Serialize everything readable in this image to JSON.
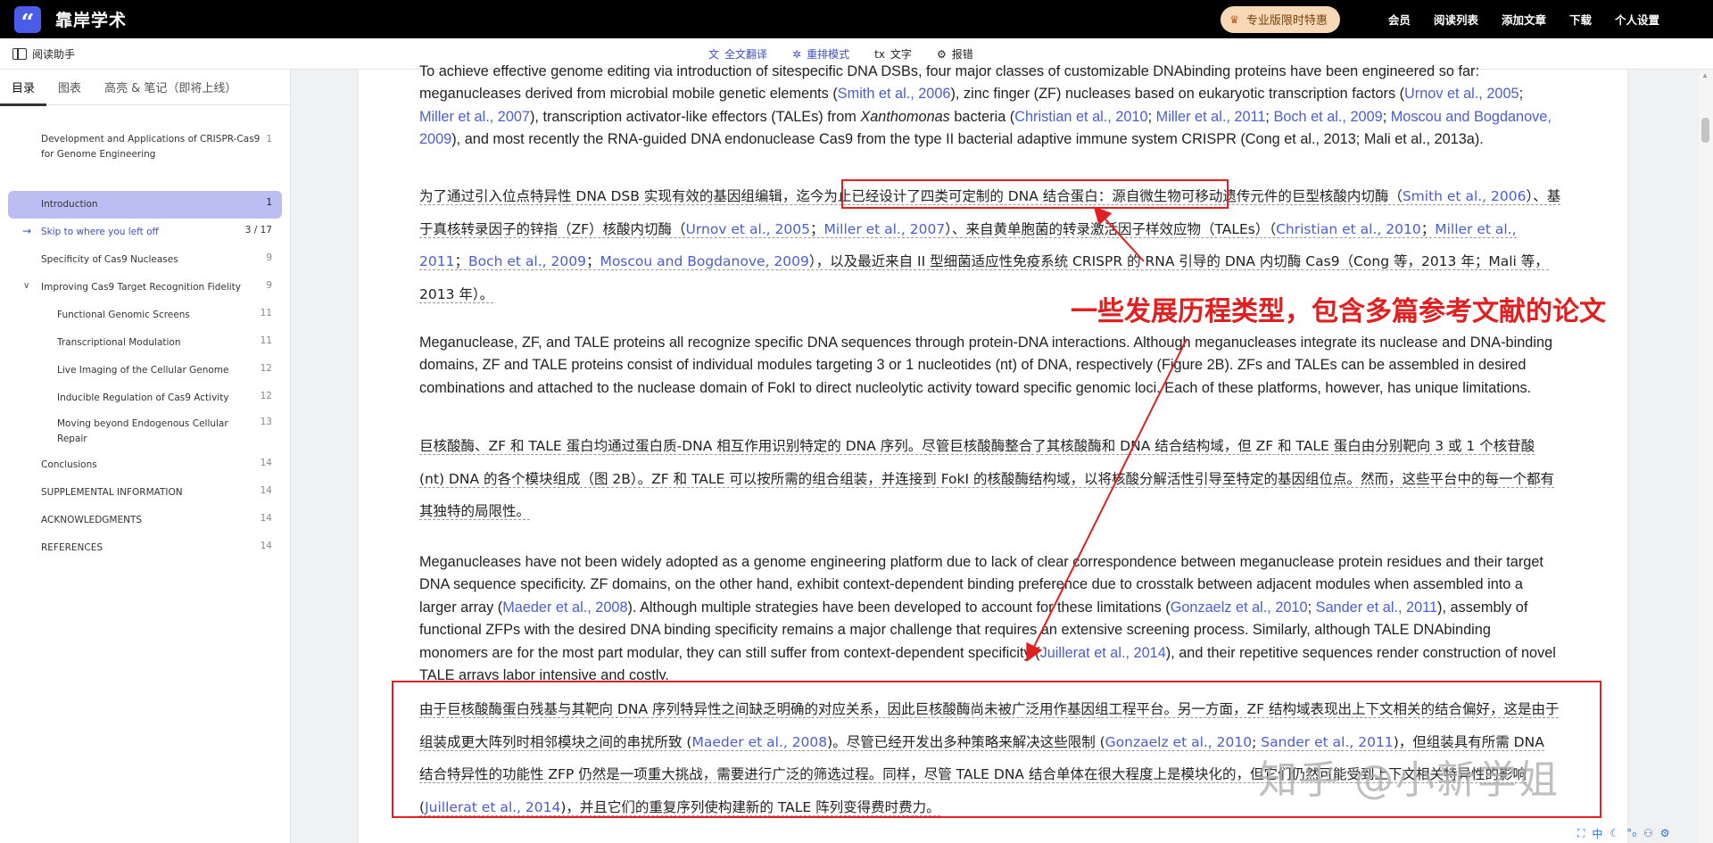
{
  "topbar": {
    "logo_glyph": "“",
    "app_title": "靠岸学术",
    "promo_label": "专业版限时特惠",
    "nav": [
      "会员",
      "阅读列表",
      "添加文章",
      "下载",
      "个人设置"
    ]
  },
  "subbar": {
    "assistant_label": "阅读助手",
    "tools": [
      {
        "icon": "translate-icon",
        "glyph": "文",
        "label": "全文翻译"
      },
      {
        "icon": "reflow-icon",
        "glyph": "✲",
        "label": "重排模式"
      },
      {
        "icon": "text-icon",
        "glyph": "tx",
        "label": "文字"
      },
      {
        "icon": "settings-icon",
        "glyph": "⚙",
        "label": "报错"
      }
    ]
  },
  "sidebar": {
    "tabs": [
      "目录",
      "图表",
      "高亮 & 笔记（即将上线）"
    ],
    "toc": [
      {
        "label": "Development and Applications of CRISPR-Cas9 for Genome Engineering",
        "page": "1"
      },
      {
        "label": "Introduction",
        "page": "1"
      },
      {
        "label": "Skip to where you left off",
        "page": "3 / 17"
      },
      {
        "label": "Specificity of Cas9 Nucleases",
        "page": "9"
      },
      {
        "label": "Improving Cas9 Target Recognition Fidelity",
        "page": "9"
      },
      {
        "label": "Functional Genomic Screens",
        "page": "11"
      },
      {
        "label": "Transcriptional Modulation",
        "page": "11"
      },
      {
        "label": "Live Imaging of the Cellular Genome",
        "page": "12"
      },
      {
        "label": "Inducible Regulation of Cas9 Activity",
        "page": "12"
      },
      {
        "label": "Moving beyond Endogenous Cellular Repair",
        "page": "13"
      },
      {
        "label": "Conclusions",
        "page": "14"
      },
      {
        "label": "SUPPLEMENTAL INFORMATION",
        "page": "14"
      },
      {
        "label": "ACKNOWLEDGMENTS",
        "page": "14"
      },
      {
        "label": "REFERENCES",
        "page": "14"
      }
    ]
  },
  "document": {
    "p1_en": [
      [
        "t",
        "To achieve effective genome editing via introduction of sitespecific DNA DSBs, four major classes of customizable DNAbinding proteins have been engineered so far: meganucleases derived from microbial mobile genetic elements ("
      ],
      [
        "c",
        "Smith et al., 2006"
      ],
      [
        "t",
        "), zinc finger (ZF) nucleases based on eukaryotic transcription factors ("
      ],
      [
        "c",
        "Urnov et al., 2005"
      ],
      [
        "t",
        "; "
      ],
      [
        "c",
        "Miller et al., 2007"
      ],
      [
        "t",
        "), transcription activator-like effectors (TALEs) from "
      ],
      [
        "i",
        "Xanthomonas"
      ],
      [
        "t",
        " bacteria ("
      ],
      [
        "c",
        "Christian et al., 2010"
      ],
      [
        "t",
        "; "
      ],
      [
        "c",
        "Miller et al., 2011"
      ],
      [
        "t",
        "; "
      ],
      [
        "c",
        "Boch et al., 2009"
      ],
      [
        "t",
        "; "
      ],
      [
        "c",
        "Moscou and Bogdanove, 2009"
      ],
      [
        "t",
        "), and most recently the RNA-guided DNA endonuclease Cas9 from the type II bacterial adaptive immune system CRISPR (Cong et al., 2013; Mali et al., 2013a)."
      ]
    ],
    "p1_zh": [
      [
        "t",
        "为了通过引入位点特异性 DNA DSB 实现有效的基因组编辑，迄今为止已经设计了四类可定制的 DNA 结合蛋白：源自微生物可移动遗传元件的巨型核酸内切酶（"
      ],
      [
        "c",
        "Smith et al., 2006"
      ],
      [
        "t",
        "）、基于真核转录因子的锌指（ZF）核酸内切酶（"
      ],
      [
        "c",
        "Urnov et al., 2005"
      ],
      [
        "t",
        "；"
      ],
      [
        "c",
        "Miller et al., 2007"
      ],
      [
        "t",
        "）、来自黄单胞菌的转录激活因子样效应物（TALEs）（"
      ],
      [
        "c",
        "Christian et al., 2010"
      ],
      [
        "t",
        "；"
      ],
      [
        "c",
        "Miller et al., 2011"
      ],
      [
        "t",
        "；"
      ],
      [
        "c",
        "Boch et al., 2009"
      ],
      [
        "t",
        "；"
      ],
      [
        "c",
        "Moscou and Bogdanove, 2009"
      ],
      [
        "t",
        "），以及最近来自 II 型细菌适应性免疫系统 CRISPR 的 RNA 引导的 DNA 内切酶 Cas9（Cong 等，2013 年；Mali 等，2013 年）。"
      ]
    ],
    "p2_en": [
      [
        "t",
        "Meganuclease, ZF, and TALE proteins all recognize specific DNA sequences through protein-DNA interactions. Although meganucleases integrate its nuclease and DNA-binding domains, ZF and TALE proteins consist of individual modules targeting 3 or 1 nucleotides (nt) of DNA, respectively (Figure 2B). ZFs and TALEs can be assembled in desired combinations and attached to the nuclease domain of FokI to direct nucleolytic activity toward specific genomic loci. Each of these platforms, however, has unique limitations."
      ]
    ],
    "p2_zh": [
      [
        "t",
        "巨核酸酶、ZF 和 TALE 蛋白均通过蛋白质-DNA 相互作用识别特定的 DNA 序列。尽管巨核酸酶整合了其核酸酶和 DNA 结合结构域，但 ZF 和 TALE 蛋白由分别靶向 3 或 1 个核苷酸 (nt) DNA 的各个模块组成（图 2B）。ZF 和 TALE 可以按所需的组合组装，并连接到 FokI 的核酸酶结构域，以将核酸分解活性引导至特定的基因组位点。然而，这些平台中的每一个都有其独特的局限性。"
      ]
    ],
    "p3_en": [
      [
        "t",
        "Meganucleases have not been widely adopted as a genome engineering platform due to lack of clear correspondence between meganuclease protein residues and their target DNA sequence specificity. ZF domains, on the other hand, exhibit context-dependent binding preference due to crosstalk between adjacent modules when assembled into a larger array ("
      ],
      [
        "c",
        "Maeder et al., 2008"
      ],
      [
        "t",
        "). Although multiple strategies have been developed to account for these limitations ("
      ],
      [
        "c",
        "Gonzaelz et al., 2010"
      ],
      [
        "t",
        "; "
      ],
      [
        "c",
        "Sander et al., 2011"
      ],
      [
        "t",
        "), assembly of functional ZFPs with the desired DNA binding specificity remains a major challenge that requires an extensive screening process. Similarly, although TALE DNAbinding monomers are for the most part modular, they can still suffer from context-dependent specificity ("
      ],
      [
        "c",
        "Juillerat et al., 2014"
      ],
      [
        "t",
        "), and their repetitive sequences render construction of novel TALE arrays labor intensive and costly."
      ]
    ],
    "p3_zh": [
      [
        "t",
        "由于巨核酸酶蛋白残基与其靶向 DNA 序列特异性之间缺乏明确的对应关系，因此巨核酸酶尚未被广泛用作基因组工程平台。另一方面，ZF 结构域表现出上下文相关的结合偏好，这是由于组装成更大阵列时相邻模块之间的串扰所致 ("
      ],
      [
        "c",
        "Maeder et al., 2008"
      ],
      [
        "t",
        ")。尽管已经开发出多种策略来解决这些限制 ("
      ],
      [
        "c",
        "Gonzaelz et al., 2010"
      ],
      [
        "t",
        "; "
      ],
      [
        "c",
        "Sander et al., 2011"
      ],
      [
        "t",
        ")，但组装具有所需 DNA 结合特异性的功能性 ZFP 仍然是一项重大挑战，需要进行广泛的筛选过程。同样，尽管 TALE DNA 结合单体在很大程度上是模块化的，但它们仍然可能受到上下文相关特异性的影响 ("
      ],
      [
        "c",
        "Juillerat et al., 2014"
      ],
      [
        "t",
        ")，并且它们的重复序列使构建新的 TALE 阵列变得费时费力。"
      ]
    ]
  },
  "annotation": {
    "callout_text": "一些发展历程类型，包含多篇参考文献的论文",
    "color": "#e02020"
  },
  "watermark": "知乎 @小新学姐",
  "mini_tools": [
    "⛶",
    "中",
    "☾",
    "°₀",
    "⚇",
    "⚙"
  ],
  "colors": {
    "accent": "#3e4fc4",
    "citation": "#4a5ed0",
    "active_toc": "#bcbdf2",
    "promo_bg": "#f7d9b8"
  }
}
